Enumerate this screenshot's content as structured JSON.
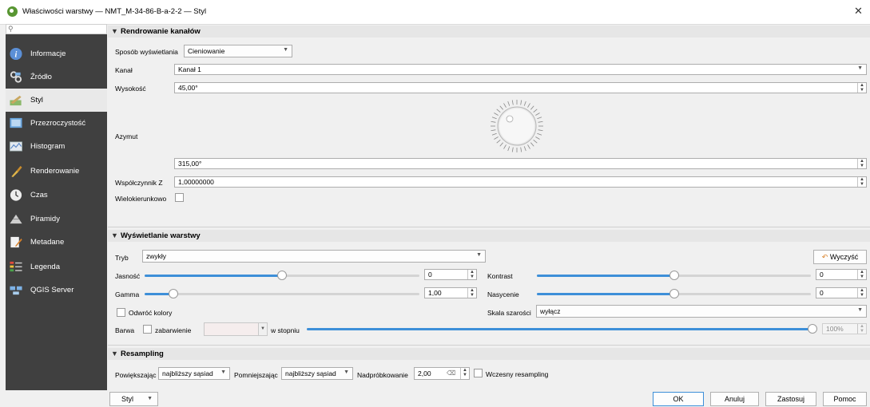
{
  "window": {
    "title": "Właściwości warstwy — NMT_M-34-86-B-a-2-2 — Styl",
    "close_glyph": "✕"
  },
  "sidebar": {
    "search_glyph": "⚲",
    "items": [
      {
        "label": "Informacje",
        "icon": "info-icon"
      },
      {
        "label": "Źródło",
        "icon": "source-icon"
      },
      {
        "label": "Styl",
        "icon": "style-icon"
      },
      {
        "label": "Przezroczystość",
        "icon": "transparency-icon"
      },
      {
        "label": "Histogram",
        "icon": "histogram-icon"
      },
      {
        "label": "Renderowanie",
        "icon": "rendering-icon"
      },
      {
        "label": "Czas",
        "icon": "time-icon"
      },
      {
        "label": "Piramidy",
        "icon": "pyramids-icon"
      },
      {
        "label": "Metadane",
        "icon": "metadata-icon"
      },
      {
        "label": "Legenda",
        "icon": "legend-icon"
      },
      {
        "label": "QGIS Server",
        "icon": "server-icon"
      }
    ],
    "active_index": 2
  },
  "band_rendering": {
    "title": "Rendrowanie kanałów",
    "render_type_label": "Sposób wyświetlania",
    "render_type_value": "Cieniowanie",
    "band_label": "Kanał",
    "band_value": "Kanał 1",
    "altitude_label": "Wysokość",
    "altitude_value": "45,00°",
    "azimuth_label": "Azymut",
    "azimuth_value": "315,00°",
    "zfactor_label": "Współczynnik Z",
    "zfactor_value": "1,00000000",
    "multidirectional_label": "Wielokierunkowo",
    "multidirectional_checked": false
  },
  "layer_rendering": {
    "title": "Wyświetlanie warstwy",
    "blend_label": "Tryb",
    "blend_value": "zwykły",
    "reset_label": "Wyczyść",
    "brightness_label": "Jasność",
    "brightness_value": "0",
    "brightness_level": 0.5,
    "contrast_label": "Kontrast",
    "contrast_value": "0",
    "contrast_level": 0.5,
    "gamma_label": "Gamma",
    "gamma_value": "1,00",
    "gamma_level": 0.09,
    "saturation_label": "Nasycenie",
    "saturation_value": "0",
    "saturation_level": 0.5,
    "invert_label": "Odwróć kolory",
    "invert_checked": false,
    "grayscale_label": "Skala szarości",
    "grayscale_value": "wyłącz",
    "hue_label": "Barwa",
    "colorize_label": "zabarwienie",
    "colorize_checked": false,
    "strength_label": "w stopniu",
    "strength_value": "100%",
    "strength_level": 1.0
  },
  "resampling": {
    "title": "Resampling",
    "zoomed_in_label": "Powiększając",
    "zoomed_in_value": "najbliższy sąsiad",
    "zoomed_out_label": "Pomniejszając",
    "zoomed_out_value": "najbliższy sąsiad",
    "oversampling_label": "Nadpróbkowanie",
    "oversampling_value": "2,00",
    "early_label": "Wczesny resampling",
    "early_checked": false
  },
  "footer": {
    "style_label": "Styl",
    "ok_label": "OK",
    "cancel_label": "Anuluj",
    "apply_label": "Zastosuj",
    "help_label": "Pomoc"
  },
  "colors": {
    "accent": "#3d8fd8",
    "sidebar_bg": "#404040",
    "sidebar_active": "#e9e9e9"
  }
}
